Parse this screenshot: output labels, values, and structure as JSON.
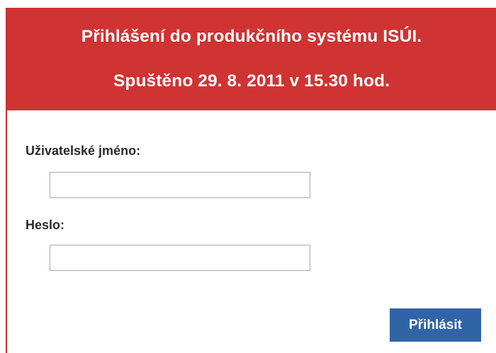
{
  "header": {
    "title_line1": "Přihlášení do produkčního systému ISÚI.",
    "title_line2": "Spuštěno 29. 8. 2011 v 15.30 hod."
  },
  "form": {
    "username_label": "Uživatelské jméno:",
    "username_value": "",
    "password_label": "Heslo:",
    "password_value": "",
    "submit_label": "Přihlásit"
  },
  "colors": {
    "header_background": "#cf3332",
    "button_background": "#3064a6",
    "panel_border": "#c9302c"
  }
}
